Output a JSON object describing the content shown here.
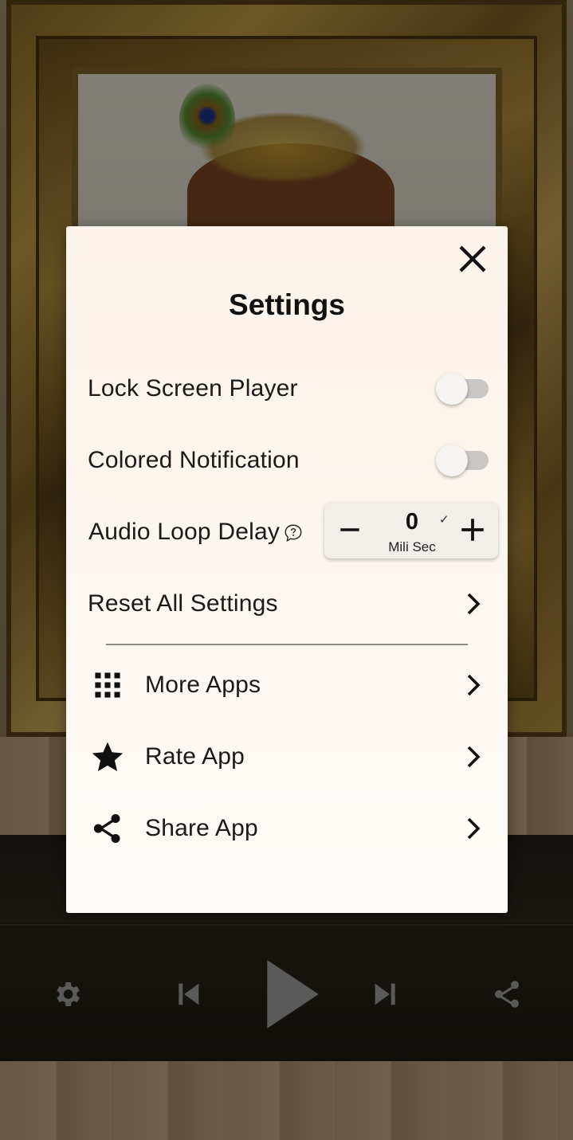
{
  "dialog": {
    "title": "Settings",
    "settings": {
      "lock_screen_player": {
        "label": "Lock Screen Player",
        "enabled": false
      },
      "colored_notification": {
        "label": "Colored Notification",
        "enabled": false
      },
      "audio_loop_delay": {
        "label": "Audio Loop Delay",
        "value": "0",
        "unit": "Mili Sec",
        "help_icon": "help-bubble-icon"
      },
      "reset_all": {
        "label": "Reset All Settings"
      }
    },
    "menu": [
      {
        "label": "More Apps",
        "icon": "grid-icon"
      },
      {
        "label": "Rate App",
        "icon": "star-icon"
      },
      {
        "label": "Share App",
        "icon": "share-icon"
      }
    ]
  },
  "player_controls": [
    "settings-icon",
    "previous-icon",
    "play-icon",
    "next-icon",
    "share-icon"
  ],
  "colors": {
    "dialog_bg": "#fbf3ea",
    "text": "#1a1a1a",
    "toggle_off": "#c9c6c3",
    "control_icons": "#8a8a8a"
  }
}
